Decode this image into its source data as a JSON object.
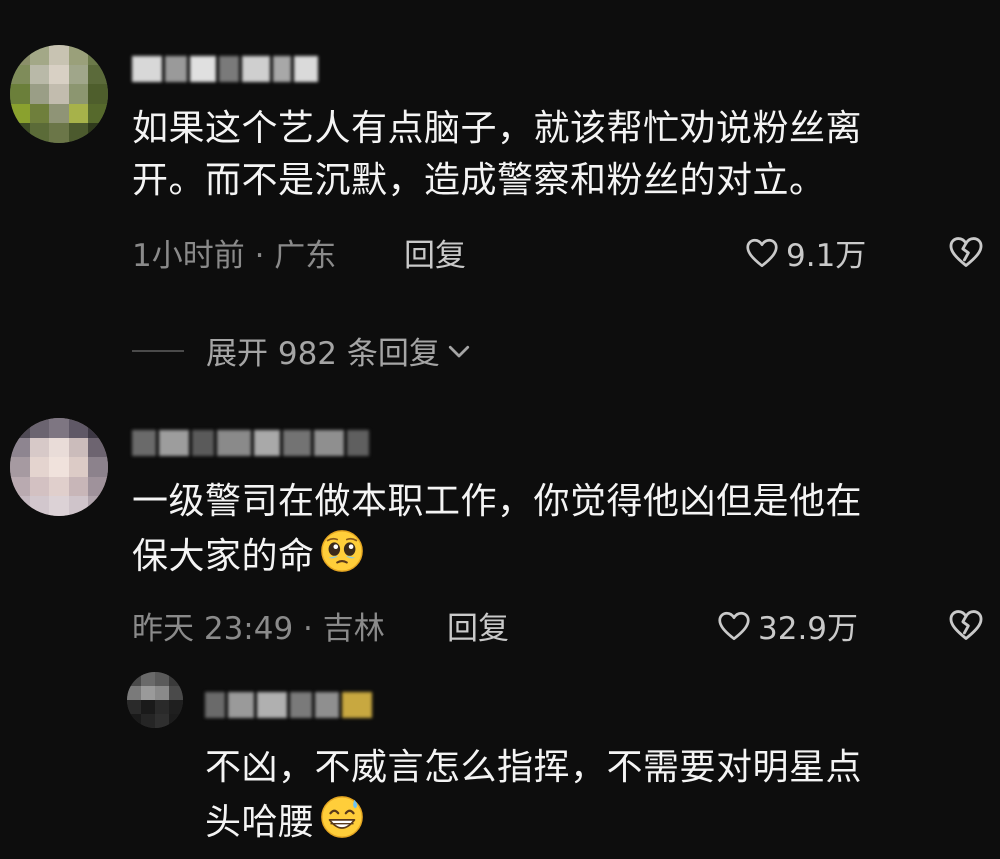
{
  "comments": [
    {
      "text_line1": "如果这个艺人有点脑子，就该帮忙劝说粉丝离",
      "text_line2": "开。而不是沉默，造成警察和粉丝的对立。",
      "meta": "1小时前 · 广东",
      "reply_label": "回复",
      "likes": "9.1万"
    },
    {
      "text_line1": "一级警司在做本职工作，你觉得他凶但是他在",
      "text_line2": "保大家的命",
      "emoji": "pleading-face-emoji",
      "meta": "昨天 23:49 · 吉林",
      "reply_label": "回复",
      "likes": "32.9万"
    }
  ],
  "expand_replies": "展开 982 条回复",
  "reply": {
    "text_line1": "不凶，不威言怎么指挥，不需要对明星点",
    "text_line2": "头哈腰",
    "emoji": "grinning-sweat-emoji"
  },
  "icons": {
    "like": "heart-outline-icon",
    "dislike": "broken-heart-icon",
    "chevron": "chevron-down-icon"
  },
  "colors": {
    "background": "#0d0d0d",
    "text": "#f4f4f4",
    "meta": "#8a8a8a",
    "secondary": "#c9c9c9"
  }
}
